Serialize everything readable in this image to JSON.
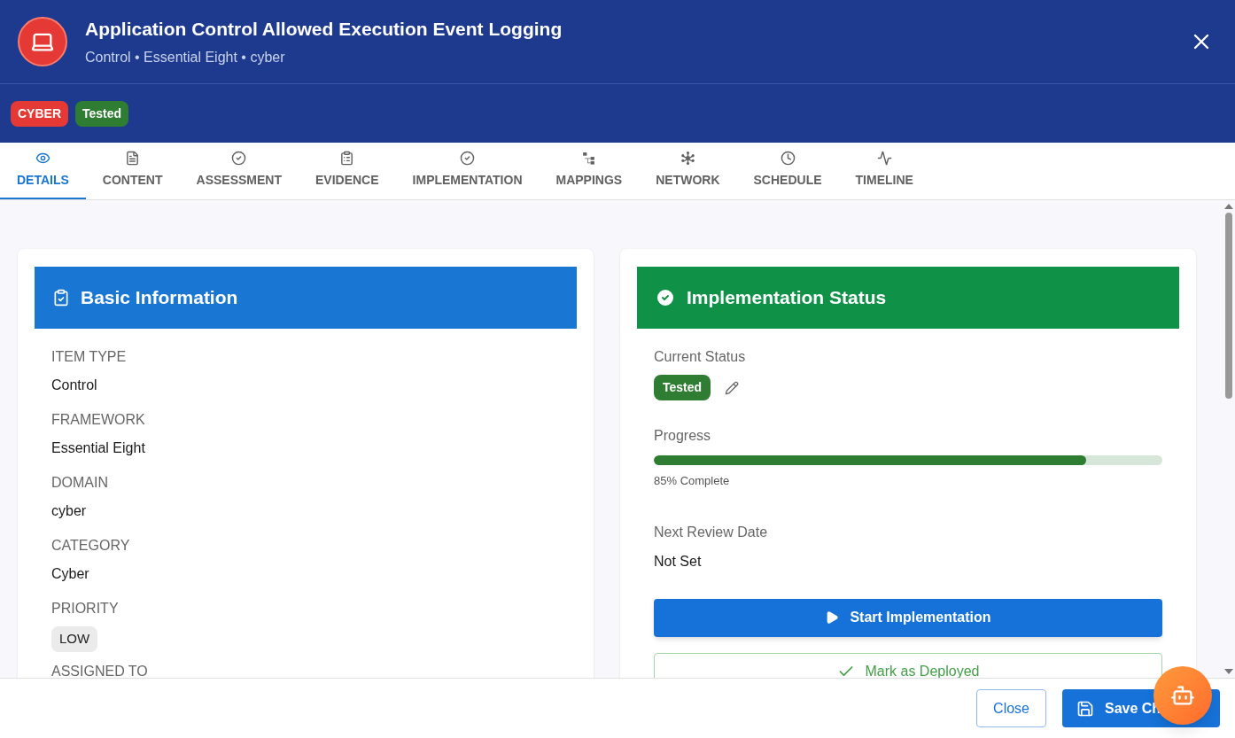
{
  "header": {
    "title": "Application Control Allowed Execution Event Logging",
    "subtitle": "Control • Essential Eight • cyber",
    "chips": [
      {
        "label": "CYBER",
        "color": "#e53935"
      },
      {
        "label": "Tested",
        "color": "#2e7d32"
      }
    ]
  },
  "tabs": [
    {
      "label": "DETAILS",
      "selected": true
    },
    {
      "label": "CONTENT",
      "selected": false
    },
    {
      "label": "ASSESSMENT",
      "selected": false
    },
    {
      "label": "EVIDENCE",
      "selected": false
    },
    {
      "label": "IMPLEMENTATION",
      "selected": false
    },
    {
      "label": "MAPPINGS",
      "selected": false
    },
    {
      "label": "NETWORK",
      "selected": false
    },
    {
      "label": "SCHEDULE",
      "selected": false
    },
    {
      "label": "TIMELINE",
      "selected": false
    }
  ],
  "basic_info": {
    "title": "Basic Information",
    "fields": [
      {
        "label": "ITEM TYPE",
        "value": "Control",
        "kind": "text"
      },
      {
        "label": "FRAMEWORK",
        "value": "Essential Eight",
        "kind": "text"
      },
      {
        "label": "DOMAIN",
        "value": "cyber",
        "kind": "text"
      },
      {
        "label": "CATEGORY",
        "value": "Cyber",
        "kind": "text"
      },
      {
        "label": "PRIORITY",
        "value": "LOW",
        "kind": "chip"
      },
      {
        "label": "ASSIGNED TO"
      }
    ]
  },
  "implementation_status": {
    "title": "Implementation Status",
    "status_label": "Current Status",
    "status": "Tested",
    "progress_label": "Progress",
    "progress": {
      "level": 0.85
    },
    "progress_text": "85% Complete",
    "review_label": "Next Review Date",
    "review_value": "Not Set",
    "primary_action": "Start Implementation",
    "secondary_action": "Mark as Deployed"
  },
  "footer": {
    "buttons": [
      {
        "label": "Close",
        "kind": "outlined"
      },
      {
        "label": "Save Ch",
        "kind": "primary"
      }
    ]
  }
}
